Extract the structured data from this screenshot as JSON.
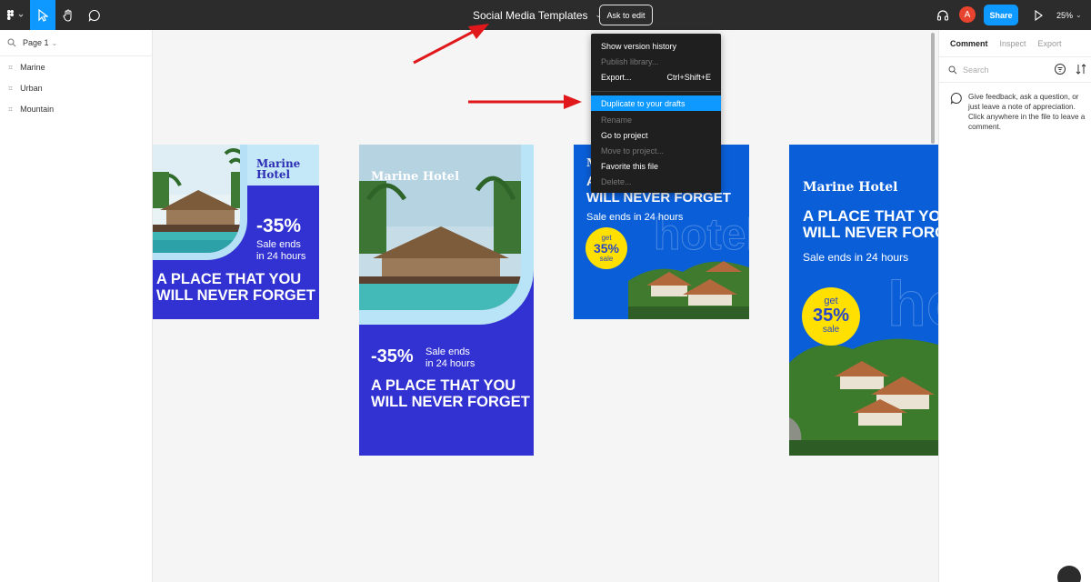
{
  "topbar": {
    "file_title": "Social Media Templates",
    "ask_to_edit": "Ask to edit",
    "avatar_initial": "A",
    "share": "Share",
    "zoom": "25%"
  },
  "left_panel": {
    "page": "Page 1",
    "layers": [
      "Marine",
      "Urban",
      "Mountain"
    ]
  },
  "right_panel": {
    "tabs": [
      "Comment",
      "Inspect",
      "Export"
    ],
    "search_placeholder": "Search",
    "note": "Give feedback, ask a question, or just leave a note of appreciation. Click anywhere in the file to leave a comment."
  },
  "menu": {
    "items": [
      {
        "label": "Show version history",
        "shortcut": "",
        "state": "enabled"
      },
      {
        "label": "Publish library...",
        "shortcut": "",
        "state": "disabled"
      },
      {
        "label": "Export...",
        "shortcut": "Ctrl+Shift+E",
        "state": "enabled"
      },
      {
        "label": "Duplicate to your drafts",
        "shortcut": "",
        "state": "highlighted"
      },
      {
        "label": "Rename",
        "shortcut": "",
        "state": "disabled"
      },
      {
        "label": "Go to project",
        "shortcut": "",
        "state": "enabled"
      },
      {
        "label": "Move to project...",
        "shortcut": "",
        "state": "disabled"
      },
      {
        "label": "Favorite this file",
        "shortcut": "",
        "state": "enabled"
      },
      {
        "label": "Delete...",
        "shortcut": "",
        "state": "disabled"
      }
    ]
  },
  "cards": {
    "card1": {
      "brand_line1": "Marine",
      "brand_line2": "Hotel",
      "discount": "-35%",
      "sale_line1": "Sale ends",
      "sale_line2": "in 24 hours",
      "headline_line1": "A PLACE THAT YOU",
      "headline_line2": "WILL NEVER FORGET"
    },
    "card2": {
      "brand": "Marine Hotel",
      "discount": "-35%",
      "sale_line1": "Sale ends",
      "sale_line2": "in 24 hours",
      "headline_line1": "A PLACE THAT YOU",
      "headline_line2": "WILL NEVER FORGET"
    },
    "card3": {
      "brand": "M",
      "headline_line1": "A",
      "headline_line2": "WILL NEVER FORGET",
      "sale": "Sale ends in 24 hours",
      "watermark": "hotel",
      "badge_top": "get",
      "badge_value": "35%",
      "badge_bottom": "sale"
    },
    "card4": {
      "brand": "Marine Hotel",
      "headline_line1": "A PLACE THAT YOU",
      "headline_line2": "WILL NEVER FORGE",
      "sale": "Sale ends in 24 hours",
      "watermark": "hote",
      "badge_top": "get",
      "badge_value": "35%",
      "badge_bottom": "sale"
    }
  },
  "colors": {
    "topbar": "#2c2c2c",
    "accent": "#0d99ff",
    "card_indigo": "#3232d2",
    "card_blue": "#0a5fd8",
    "badge_yellow": "#ffe000",
    "annotation_arrow": "#e0181b"
  }
}
